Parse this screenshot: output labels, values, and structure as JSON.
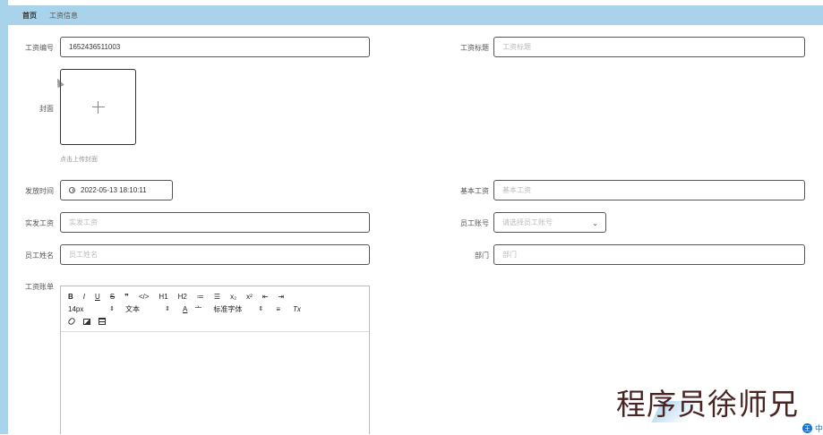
{
  "breadcrumb": {
    "home": "首页",
    "current": "工资信息"
  },
  "form": {
    "salary_no": {
      "label": "工资编号",
      "value": "1652436511003"
    },
    "salary_title": {
      "label": "工资标题",
      "placeholder": "工资标题"
    },
    "cover": {
      "label": "封面",
      "hint": "点击上传封面"
    },
    "pay_time": {
      "label": "发放时间",
      "value": "2022-05-13 18:10:11"
    },
    "base_salary": {
      "label": "基本工资",
      "placeholder": "基本工资"
    },
    "actual_salary": {
      "label": "实发工资",
      "placeholder": "实发工资"
    },
    "employee_account": {
      "label": "员工账号",
      "placeholder": "请选择员工账号"
    },
    "employee_name": {
      "label": "员工姓名",
      "placeholder": "员工姓名"
    },
    "department": {
      "label": "部门",
      "placeholder": "部门"
    },
    "payslip": {
      "label": "工资账单"
    }
  },
  "editor": {
    "row1": [
      "B",
      "I",
      "U",
      "S",
      "❞",
      "</>",
      "H1",
      "H2",
      "≔",
      "☰",
      "x₂",
      "x²",
      "⇤",
      "⇥"
    ],
    "font_size": "14px",
    "text_style": "文本",
    "font_color": "A",
    "bg_color": "亠",
    "font_family": "标准字体",
    "align": "≡",
    "clear": "Tx",
    "media": [
      "link-icon",
      "image-icon",
      "video-icon"
    ]
  },
  "watermark": "程序员徐师兄",
  "ime": {
    "badge": "王",
    "mode": "中"
  }
}
